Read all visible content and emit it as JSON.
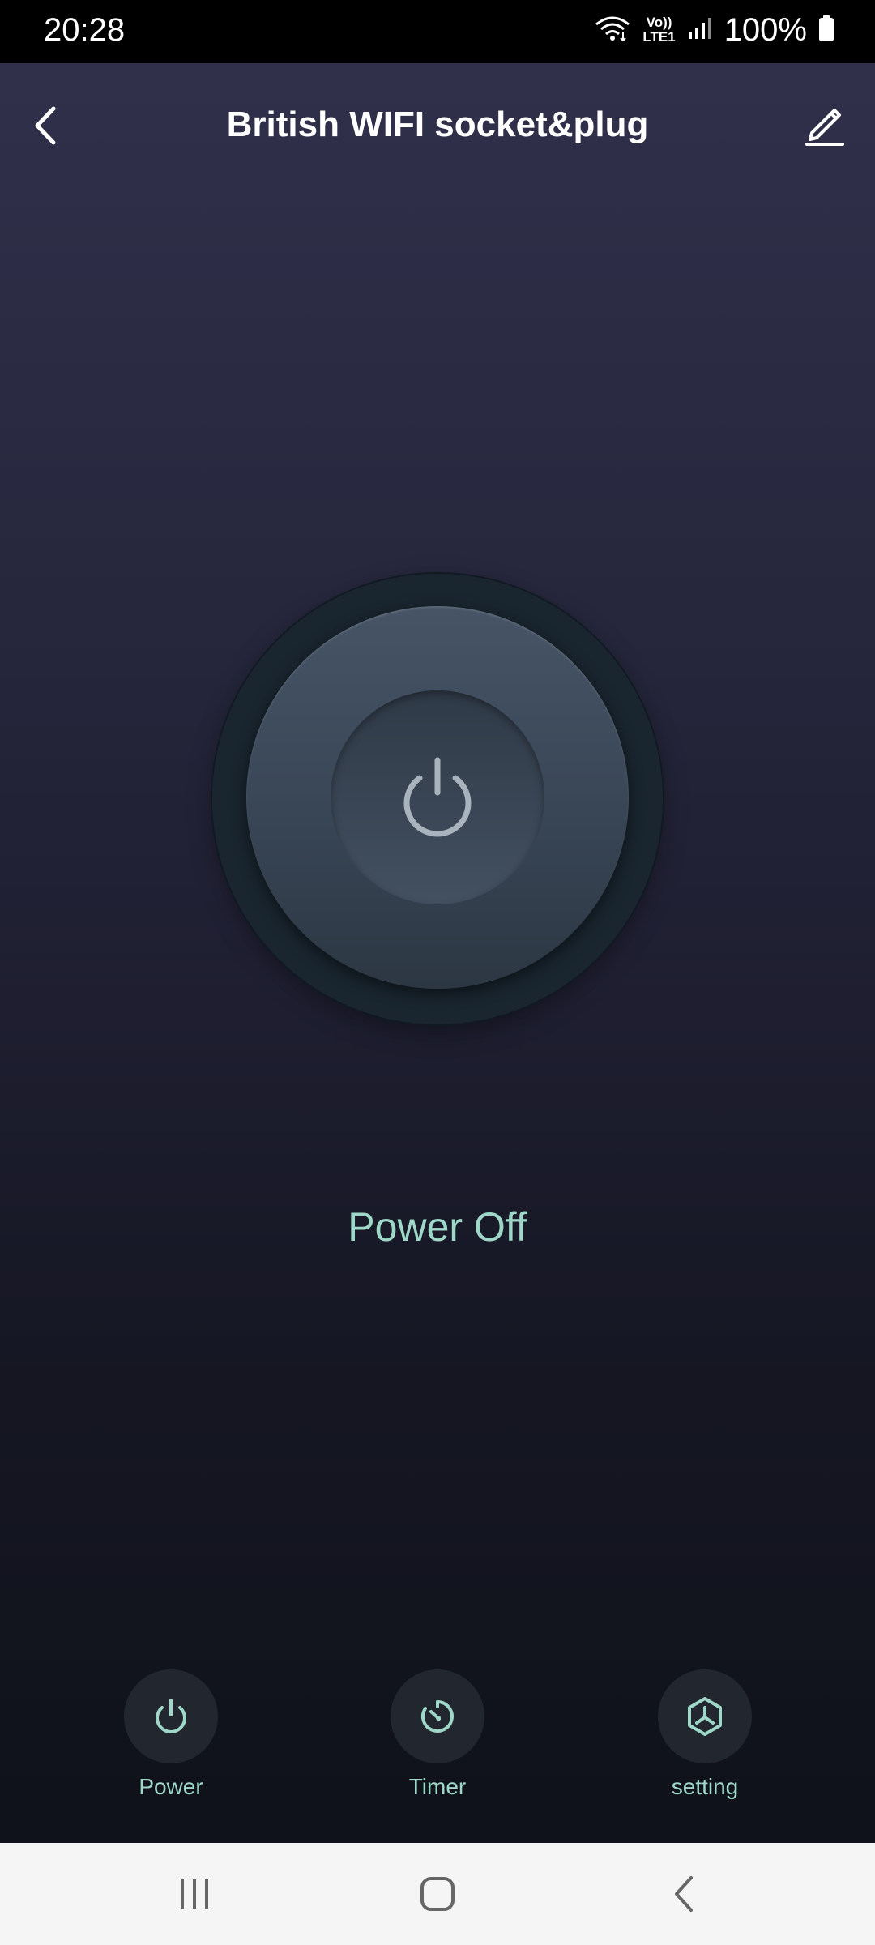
{
  "status_bar": {
    "time": "20:28",
    "network_label": "Vo))\nLTE1",
    "battery": "100%"
  },
  "header": {
    "title": "British WIFI socket&plug",
    "back_icon": "chevron-left-icon",
    "edit_icon": "pencil-icon"
  },
  "main": {
    "power_icon": "power-icon",
    "status": "Power Off"
  },
  "actions": [
    {
      "label": "Power",
      "icon": "power-icon"
    },
    {
      "label": "Timer",
      "icon": "timer-icon"
    },
    {
      "label": "setting",
      "icon": "settings-cube-icon"
    }
  ],
  "nav": {
    "recent_icon": "recent-apps-icon",
    "home_icon": "home-icon",
    "back_icon": "back-icon"
  },
  "colors": {
    "accent": "#9fd8c9",
    "title": "#ffffff",
    "background_top": "#30304b",
    "background_bottom": "#0f121a"
  }
}
